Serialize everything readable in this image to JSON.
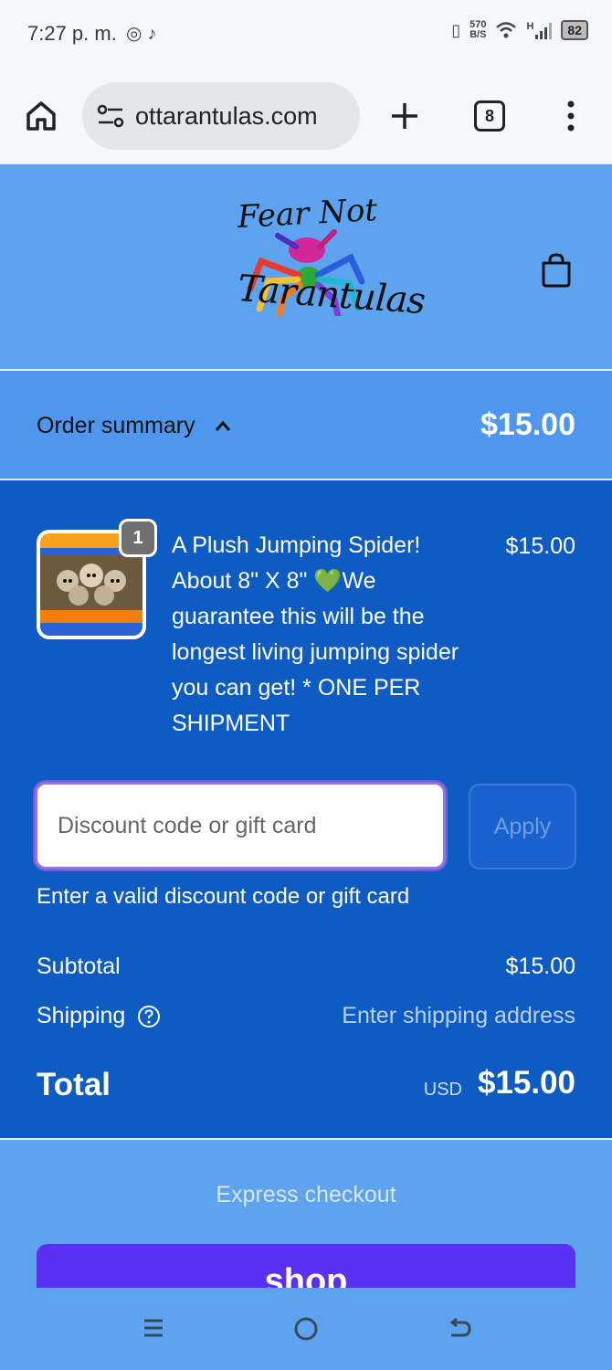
{
  "status_bar": {
    "time": "7:27 p. m.",
    "net_speed_value": "570",
    "net_speed_unit": "B/S",
    "signal_label": "H",
    "battery": "82"
  },
  "browser": {
    "url": "ottarantulas.com",
    "tab_count": "8"
  },
  "store": {
    "logo_line1": "Fear Not",
    "logo_line2": "Tarantulas"
  },
  "summary": {
    "label": "Order summary",
    "total": "$15.00"
  },
  "line_item": {
    "quantity": "1",
    "title": "A Plush Jumping Spider! About 8\" X 8\" 💚We guarantee this will be the longest living jumping spider you can get! * ONE PER SHIPMENT",
    "price": "$15.00"
  },
  "discount": {
    "placeholder": "Discount code or gift card",
    "value": "",
    "apply_label": "Apply",
    "error": "Enter a valid discount code or gift card"
  },
  "totals": {
    "subtotal_label": "Subtotal",
    "subtotal_value": "$15.00",
    "shipping_label": "Shipping",
    "shipping_value": "Enter shipping address",
    "total_label": "Total",
    "currency": "USD",
    "total_value": "$15.00"
  },
  "express": {
    "label": "Express checkout",
    "shop_pay_label": "shop"
  },
  "colors": {
    "header_bg": "#5ea3ef",
    "summary_bg": "#4f97ee",
    "panel_bg": "#0e5bc4",
    "shop_pay": "#5a31f4",
    "input_focus": "#8f73e8"
  },
  "icons": {
    "status_apps": [
      "whatsapp-icon",
      "tiktok-icon"
    ],
    "status_system": [
      "vibrate-icon",
      "wifi-icon",
      "signal-icon",
      "battery-icon"
    ],
    "toolbar": [
      "home-icon",
      "site-settings-icon",
      "new-tab-icon",
      "tab-switcher-icon",
      "more-menu-icon"
    ],
    "cart": "shopping-bag-icon",
    "nav": [
      "recent-apps-icon",
      "home-circle-icon",
      "back-icon"
    ]
  }
}
